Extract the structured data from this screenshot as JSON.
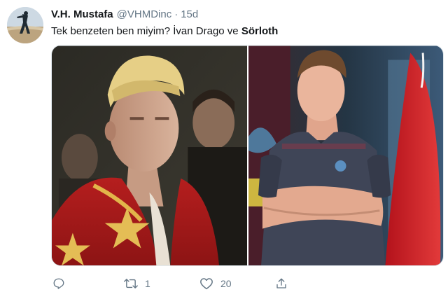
{
  "tweet": {
    "display_name": "V.H. Mustafa",
    "handle": "@VHMDinc",
    "separator": "·",
    "time": "15d",
    "text_prefix": "Tek benzeten ben miyim? İvan Drago ve ",
    "text_bold": "Sörloth"
  },
  "actions": {
    "reply_count": "",
    "retweet_count": "1",
    "like_count": "20"
  },
  "icons": {
    "reply": "reply-icon",
    "retweet": "retweet-icon",
    "like": "heart-icon",
    "share": "share-icon"
  },
  "colors": {
    "text_primary": "#14171a",
    "text_secondary": "#657786",
    "border": "#e1e8ed"
  }
}
